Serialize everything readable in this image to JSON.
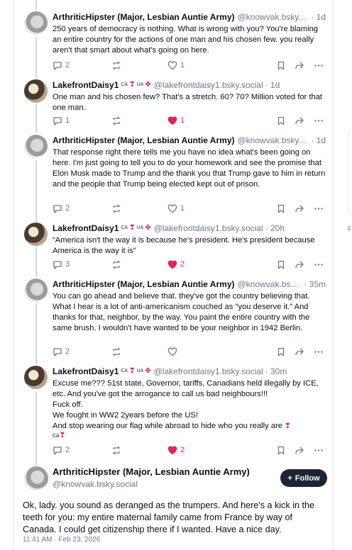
{
  "posts": [
    {
      "name": "ArthriticHipster (Major, Lesbian Auntie Army)",
      "handle": "@knowvak.bsky.so...",
      "time": "· 1d",
      "text": "250 years of democracy is nothing. What is wrong with you? You're blaming an entire country for the actions of one man and his chosen few. you really aren't that smart about what's going on here.",
      "replies": "2",
      "likes": "1",
      "liked": false
    },
    {
      "name": "LakefrontDaisy1",
      "flag1": "CA",
      "flag2": "UA",
      "handle": "@lakefrontdaisy1.bsky.social",
      "time": "· 1d",
      "text": "One man and his chosen few? That's a stretch. 60? 70? Million voted for that one man.",
      "replies": "1",
      "likes": "1",
      "liked": true
    },
    {
      "name": "ArthriticHipster (Major, Lesbian Auntie Army)",
      "handle": "@knowvak.bsky.so...",
      "time": "· 1d",
      "text": "That response right there tells me you have no idea what's been going on here. I'm just going to tell you to do your homework and see the promise that Elon Musk made to Trump and the thank you that Trump gave to him in return and the people that Trump being elected kept out of prison.",
      "replies": "2",
      "likes": "1",
      "liked": false
    },
    {
      "name": "LakefrontDaisy1",
      "flag1": "CA",
      "flag2": "UA",
      "handle": "@lakefrontdaisy1.bsky.social",
      "time": "· 20h",
      "text": "“America isn't the way it is because he's president. He's president because America is the way it is”",
      "replies": "3",
      "likes": "2",
      "liked": true
    },
    {
      "name": "ArthriticHipster (Major, Lesbian Auntie Army)",
      "handle": "@knowvak.bsky.s...",
      "time": "· 35m",
      "text": "You can go ahead and believe that. they've got the country believing that. What I hear is a lot of anti-americanism couched as \"you deserve it.\" And thanks for that, neighbor, by the way. You paint the entire country with the same brush. I wouldn't have wanted to be your neighbor in 1942 Berlin.",
      "replies": "2",
      "likes": "",
      "liked": false
    },
    {
      "name": "LakefrontDaisy1",
      "flag1": "CA",
      "flag2": "UA",
      "handle": "@lakefrontdaisy1.bsky.social",
      "time": "· 30m",
      "lines": [
        "Excuse me???  51st state, Governor, tariffs, Canadians held illegally by ICE, etc. And you've got the arrogance to call us bad neighbours!!!",
        "Fuck off.",
        "We fought in WW2 2years before the US!",
        "And stop wearing our flag while abroad to hide who you really are"
      ],
      "trail_flag": "CA",
      "replies": "2",
      "likes": "2",
      "liked": true
    }
  ],
  "focus": {
    "name": "ArthriticHipster (Major, Lesbian Auntie Army)",
    "handle": "@knowvak.bsky.social",
    "follow_label": "Follow",
    "text": "Ok, lady. you sound as deranged as the trumpers. And here's a kick in the teeth for you: my entire maternal family came from France by way of Canada. I could get citizenship there if I wanted. Have a nice day.",
    "timestamp": "11:41 AM · Feb 23, 2026"
  },
  "side": {
    "letter": "F"
  },
  "colors": {
    "like": "#e0245e",
    "muted": "#6f7a88",
    "follow_bg": "#1c2533"
  }
}
